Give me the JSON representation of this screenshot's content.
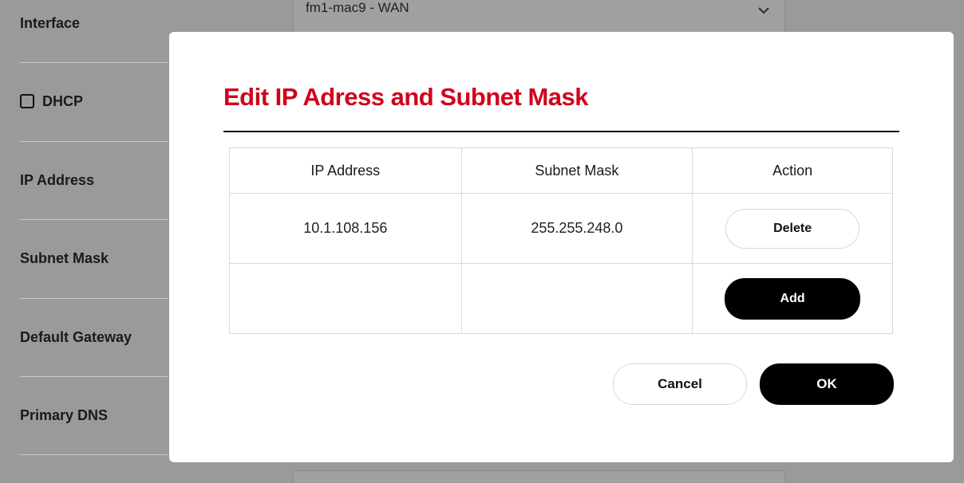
{
  "form": {
    "rows": [
      {
        "label": "Interface"
      },
      {
        "label": "DHCP",
        "checkbox": true,
        "checked": false
      },
      {
        "label": "IP Address"
      },
      {
        "label": "Subnet Mask"
      },
      {
        "label": "Default Gateway"
      },
      {
        "label": "Primary DNS"
      }
    ],
    "interface_value": "fm1-mac9 - WAN"
  },
  "dialog": {
    "title": "Edit IP Adress and Subnet Mask",
    "table": {
      "headers": [
        "IP Address",
        "Subnet Mask",
        "Action"
      ],
      "rows": [
        {
          "ip": "10.1.108.156",
          "mask": "255.255.248.0",
          "action_label": "Delete"
        }
      ],
      "add_label": "Add"
    },
    "cancel_label": "Cancel",
    "ok_label": "OK"
  }
}
